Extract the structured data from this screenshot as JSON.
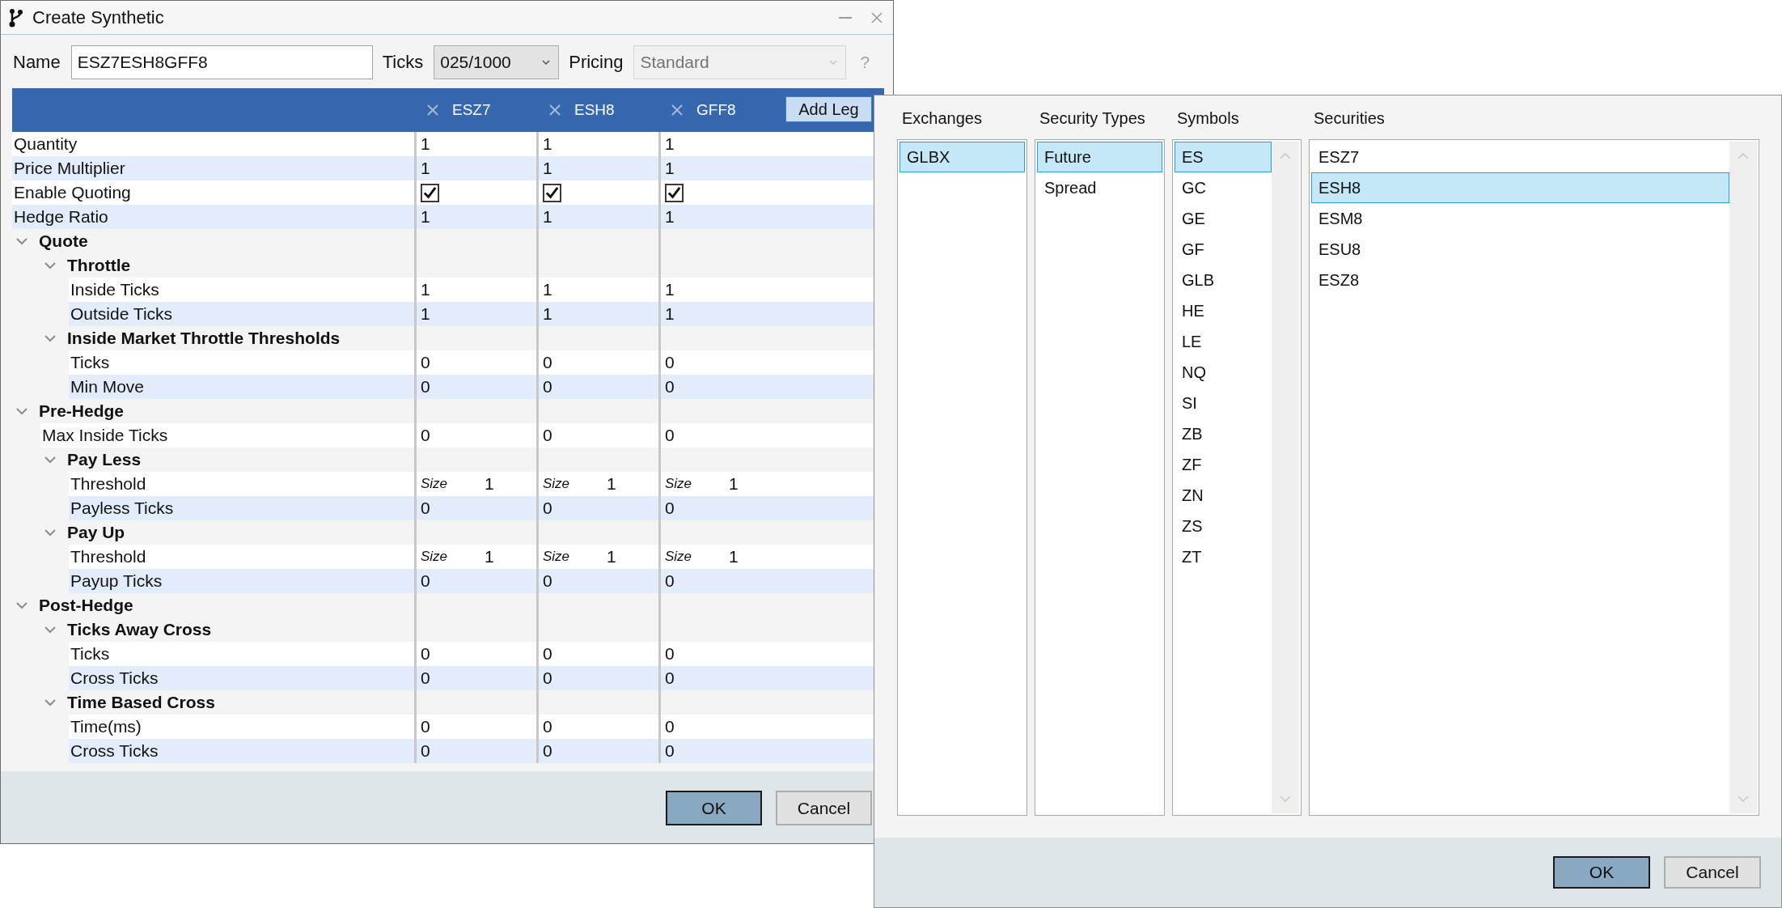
{
  "dialog": {
    "title": "Create Synthetic",
    "fields": [
      {
        "kind": "text",
        "label": "Name",
        "value": "ESZ7ESH8GFF8"
      },
      {
        "kind": "dropdown",
        "label": "Ticks",
        "value": "025/1000",
        "disabled": false
      },
      {
        "kind": "dropdown",
        "label": "Pricing",
        "value": "Standard",
        "disabled": true
      }
    ],
    "help": "?",
    "legs": [
      {
        "name": "ESZ7"
      },
      {
        "name": "ESH8"
      },
      {
        "name": "GFF8"
      }
    ],
    "add_leg": "Add Leg",
    "rows": [
      {
        "kind": "number",
        "label": "Quantity",
        "values": [
          "1",
          "1",
          "1"
        ]
      },
      {
        "kind": "number",
        "label": "Price Multiplier",
        "values": [
          "1",
          "1",
          "1"
        ]
      },
      {
        "kind": "checkbox",
        "label": "Enable Quoting",
        "values": [
          {
            "checked": true
          },
          {
            "checked": true
          },
          {
            "checked": true
          }
        ]
      },
      {
        "kind": "number",
        "label": "Hedge Ratio",
        "values": [
          "1",
          "1",
          "1"
        ]
      },
      {
        "kind": "group",
        "label": "Quote",
        "expanded": true,
        "children": [
          {
            "kind": "group",
            "label": "Throttle",
            "expanded": true,
            "children": [
              {
                "kind": "number",
                "label": "Inside Ticks",
                "values": [
                  "1",
                  "1",
                  "1"
                ]
              },
              {
                "kind": "number",
                "label": "Outside Ticks",
                "values": [
                  "1",
                  "1",
                  "1"
                ]
              }
            ]
          },
          {
            "kind": "group",
            "label": "Inside Market Throttle Thresholds",
            "expanded": true,
            "children": [
              {
                "kind": "number",
                "label": "Ticks",
                "values": [
                  "0",
                  "0",
                  "0"
                ]
              },
              {
                "kind": "number",
                "label": "Min Move",
                "values": [
                  "0",
                  "0",
                  "0"
                ]
              }
            ]
          }
        ]
      },
      {
        "kind": "group",
        "label": "Pre-Hedge",
        "expanded": true,
        "children": [
          {
            "kind": "number",
            "label": "Max Inside Ticks",
            "values": [
              "0",
              "0",
              "0"
            ]
          },
          {
            "kind": "group",
            "label": "Pay Less",
            "expanded": true,
            "children": [
              {
                "kind": "size",
                "label": "Threshold",
                "values": [
                  {
                    "tag": "Size",
                    "value": "1"
                  },
                  {
                    "tag": "Size",
                    "value": "1"
                  },
                  {
                    "tag": "Size",
                    "value": "1"
                  }
                ]
              },
              {
                "kind": "number",
                "label": "Payless Ticks",
                "values": [
                  "0",
                  "0",
                  "0"
                ]
              }
            ]
          },
          {
            "kind": "group",
            "label": "Pay Up",
            "expanded": true,
            "children": [
              {
                "kind": "size",
                "label": "Threshold",
                "values": [
                  {
                    "tag": "Size",
                    "value": "1"
                  },
                  {
                    "tag": "Size",
                    "value": "1"
                  },
                  {
                    "tag": "Size",
                    "value": "1"
                  }
                ]
              },
              {
                "kind": "number",
                "label": "Payup Ticks",
                "values": [
                  "0",
                  "0",
                  "0"
                ]
              }
            ]
          }
        ]
      },
      {
        "kind": "group",
        "label": "Post-Hedge",
        "expanded": true,
        "children": [
          {
            "kind": "group",
            "label": "Ticks Away Cross",
            "expanded": true,
            "children": [
              {
                "kind": "number",
                "label": "Ticks",
                "values": [
                  "0",
                  "0",
                  "0"
                ]
              },
              {
                "kind": "number",
                "label": "Cross Ticks",
                "values": [
                  "0",
                  "0",
                  "0"
                ]
              }
            ]
          },
          {
            "kind": "group",
            "label": "Time Based Cross",
            "expanded": true,
            "children": [
              {
                "kind": "number",
                "label": "Time(ms)",
                "values": [
                  "0",
                  "0",
                  "0"
                ]
              },
              {
                "kind": "number",
                "label": "Cross Ticks",
                "values": [
                  "0",
                  "0",
                  "0"
                ]
              }
            ]
          }
        ]
      }
    ],
    "buttons": [
      {
        "label": "OK",
        "default": true
      },
      {
        "label": "Cancel",
        "default": false
      }
    ]
  },
  "picker": {
    "columns": [
      {
        "title": "Exchanges",
        "scrollable": false,
        "items": [
          {
            "label": "GLBX",
            "selected": true
          }
        ]
      },
      {
        "title": "Security Types",
        "scrollable": false,
        "items": [
          {
            "label": "Future",
            "selected": true
          },
          {
            "label": "Spread",
            "selected": false
          }
        ]
      },
      {
        "title": "Symbols",
        "scrollable": true,
        "items": [
          {
            "label": "ES",
            "selected": true
          },
          {
            "label": "GC",
            "selected": false
          },
          {
            "label": "GE",
            "selected": false
          },
          {
            "label": "GF",
            "selected": false
          },
          {
            "label": "GLB",
            "selected": false
          },
          {
            "label": "HE",
            "selected": false
          },
          {
            "label": "LE",
            "selected": false
          },
          {
            "label": "NQ",
            "selected": false
          },
          {
            "label": "SI",
            "selected": false
          },
          {
            "label": "ZB",
            "selected": false
          },
          {
            "label": "ZF",
            "selected": false
          },
          {
            "label": "ZN",
            "selected": false
          },
          {
            "label": "ZS",
            "selected": false
          },
          {
            "label": "ZT",
            "selected": false
          }
        ]
      },
      {
        "title": "Securities",
        "scrollable": true,
        "items": [
          {
            "label": "ESZ7",
            "selected": false
          },
          {
            "label": "ESH8",
            "selected": true
          },
          {
            "label": "ESM8",
            "selected": false
          },
          {
            "label": "ESU8",
            "selected": false
          },
          {
            "label": "ESZ8",
            "selected": false
          }
        ]
      }
    ],
    "buttons": [
      {
        "label": "OK",
        "default": true
      },
      {
        "label": "Cancel",
        "default": false
      }
    ]
  }
}
